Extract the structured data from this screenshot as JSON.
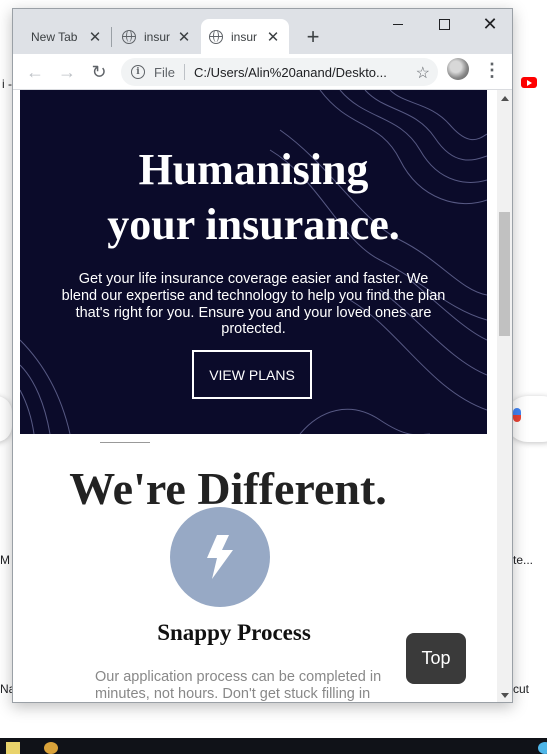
{
  "tabs": [
    {
      "title": "New Tab",
      "active": false,
      "has_favicon": false
    },
    {
      "title": "insur",
      "active": false,
      "has_favicon": true
    },
    {
      "title": "insur",
      "active": true,
      "has_favicon": true
    }
  ],
  "address_bar": {
    "scheme_label": "File",
    "url": "C:/Users/Alin%20anand/Deskto..."
  },
  "hero": {
    "title_line1": "Humanising",
    "title_line2": "your insurance.",
    "description": "Get your life insurance coverage easier and faster. We blend our expertise and technology to help you find the plan that's right for you. Ensure you and your loved ones are protected.",
    "cta_label": "VIEW PLANS",
    "background_color": "#0b0b2a"
  },
  "section": {
    "title": "We're Different.",
    "feature": {
      "icon": "lightning-bolt-icon",
      "icon_bg_color": "#97a9c5",
      "title": "Snappy Process",
      "description": "Our application process can be completed in minutes, not hours. Don't get stuck filling in"
    }
  },
  "top_button_label": "Top",
  "background_fragments": {
    "left_m": "M",
    "left_na": "Na",
    "right_te": "te...",
    "right_cut": "cut",
    "top_left": "i -"
  }
}
